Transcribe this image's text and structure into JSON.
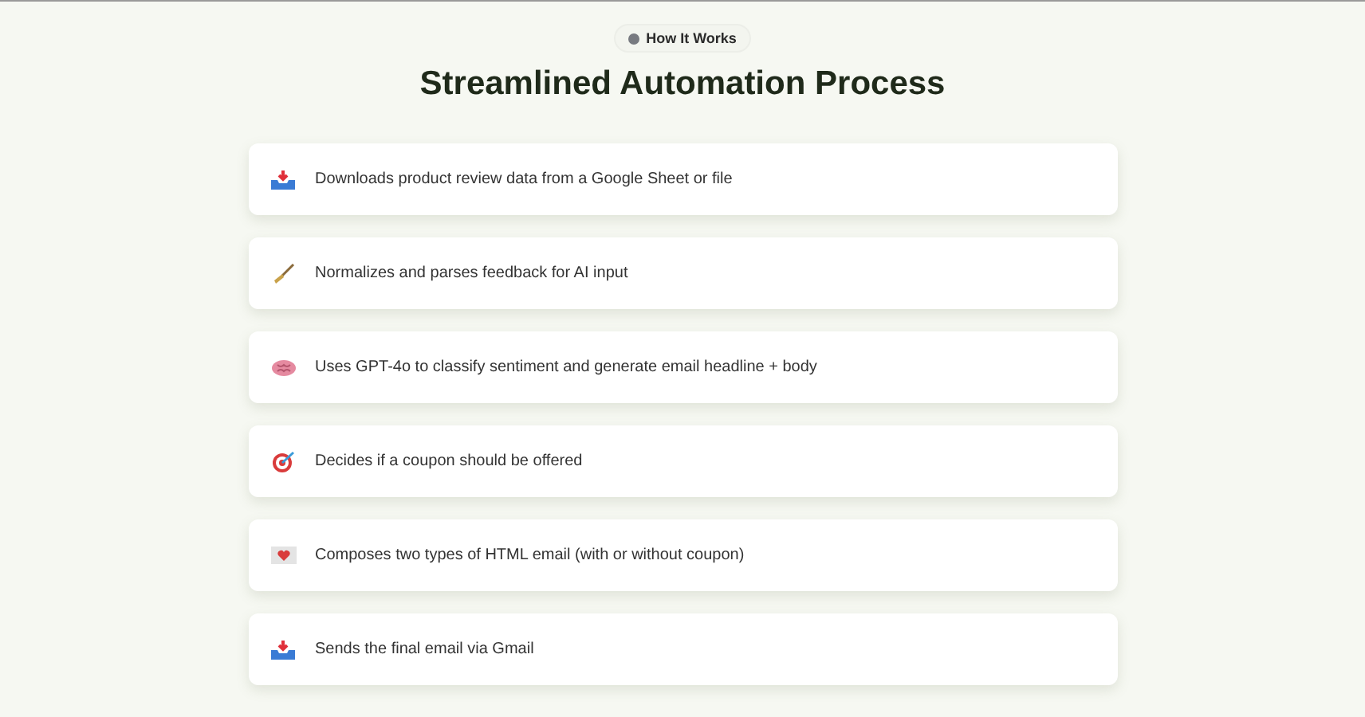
{
  "badge": {
    "label": "How It Works"
  },
  "title": "Streamlined Automation Process",
  "steps": [
    {
      "kind": "tray",
      "text": "Downloads product review data from a Google Sheet or file"
    },
    {
      "kind": "broom",
      "text": "Normalizes and parses feedback for AI input"
    },
    {
      "kind": "brain",
      "text": "Uses GPT-4o to classify sentiment and generate email headline + body"
    },
    {
      "kind": "target",
      "text": "Decides if a coupon should be offered"
    },
    {
      "kind": "envelope",
      "text": "Composes two types of HTML email (with or without coupon)"
    },
    {
      "kind": "tray",
      "text": "Sends the final email via Gmail"
    }
  ]
}
